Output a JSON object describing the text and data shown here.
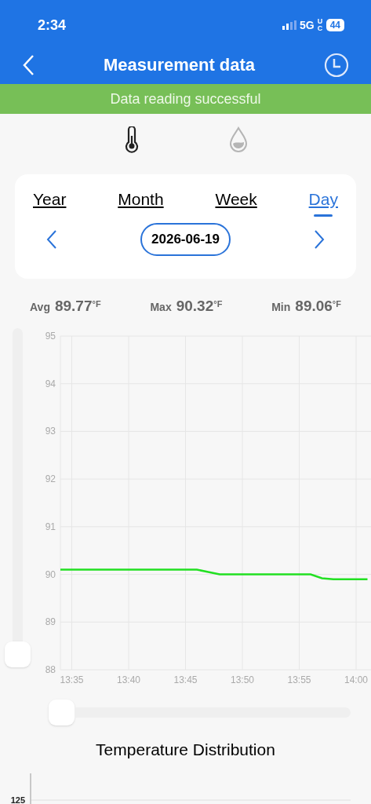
{
  "status_bar": {
    "time": "2:34",
    "network": "5G",
    "network_badge": "UC",
    "battery": "44"
  },
  "nav": {
    "title": "Measurement data"
  },
  "banner": {
    "text": "Data reading successful"
  },
  "sensors": [
    {
      "kind": "temperature",
      "selected": true
    },
    {
      "kind": "humidity",
      "selected": false
    }
  ],
  "periods": [
    {
      "label": "Year",
      "selected": false
    },
    {
      "label": "Month",
      "selected": false
    },
    {
      "label": "Week",
      "selected": false
    },
    {
      "label": "Day",
      "selected": true
    }
  ],
  "date": "2026-06-19",
  "stats": [
    {
      "label": "Avg",
      "value": "89.77",
      "unit": "°F"
    },
    {
      "label": "Max",
      "value": "90.32",
      "unit": "°F"
    },
    {
      "label": "Min",
      "value": "89.06",
      "unit": "°F"
    }
  ],
  "chart": {
    "chart_data": {
      "type": "line",
      "grid": true,
      "ylim": [
        88,
        95
      ],
      "yticks": [
        88,
        89,
        90,
        91,
        92,
        93,
        94,
        95
      ],
      "categories": [
        null,
        "13:35",
        null,
        null,
        null,
        null,
        "13:40",
        null,
        null,
        null,
        null,
        "13:45",
        null,
        null,
        null,
        null,
        "13:50",
        null,
        null,
        null,
        null,
        "13:55",
        null,
        null,
        null,
        null,
        "14:00",
        null
      ],
      "series": [
        {
          "color": "#22e022",
          "values": [
            90.1,
            90.1,
            90.1,
            90.1,
            90.1,
            90.1,
            90.1,
            90.1,
            90.1,
            90.1,
            90.1,
            90.1,
            90.1,
            90.05,
            90.0,
            90.0,
            90.0,
            90.0,
            90.0,
            90.0,
            90.0,
            90.0,
            90.0,
            89.92,
            89.9,
            89.9,
            89.9,
            89.9
          ]
        }
      ]
    }
  },
  "distribution": {
    "title": "Temperature Distribution",
    "axis_labels": [
      "125"
    ]
  }
}
